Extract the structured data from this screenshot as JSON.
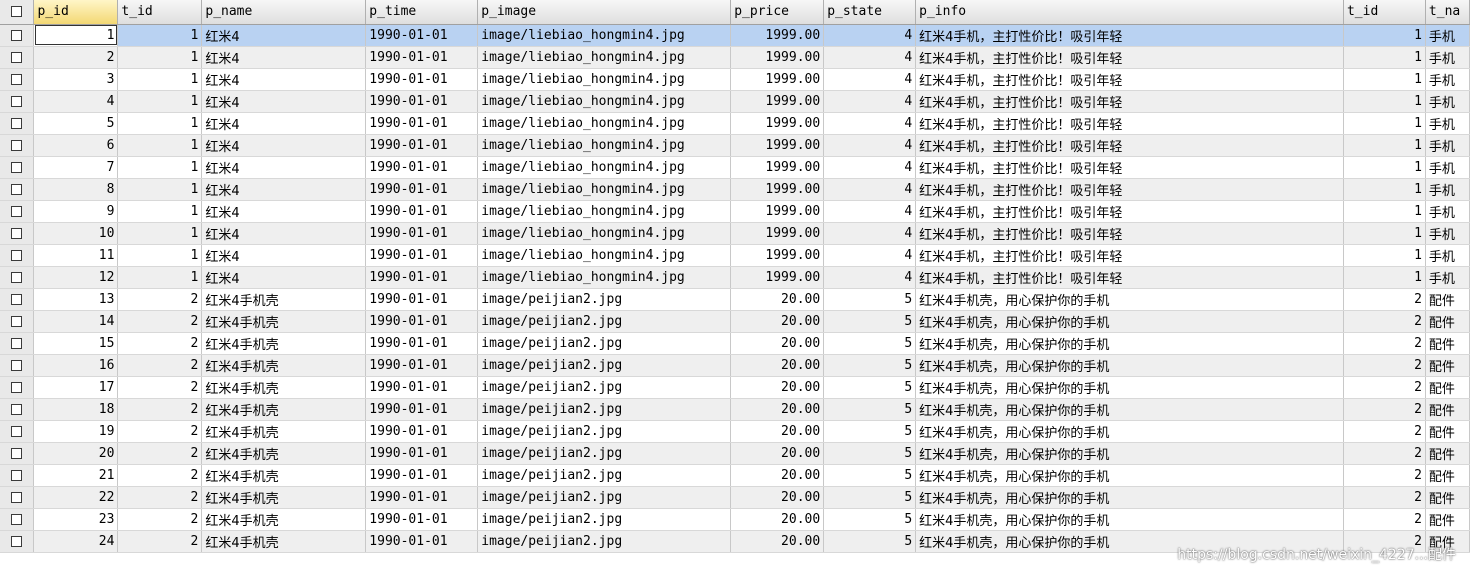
{
  "columns": [
    "p_id",
    "t_id",
    "p_name",
    "p_time",
    "p_image",
    "p_price",
    "p_state",
    "p_info",
    "t_id",
    "t_na"
  ],
  "rows": [
    [
      "1",
      "1",
      "红米4",
      "1990-01-01",
      "image/liebiao_hongmin4.jpg",
      "1999.00",
      "4",
      "红米4手机，主打性价比！吸引年轻",
      "1",
      "手机"
    ],
    [
      "2",
      "1",
      "红米4",
      "1990-01-01",
      "image/liebiao_hongmin4.jpg",
      "1999.00",
      "4",
      "红米4手机，主打性价比！吸引年轻",
      "1",
      "手机"
    ],
    [
      "3",
      "1",
      "红米4",
      "1990-01-01",
      "image/liebiao_hongmin4.jpg",
      "1999.00",
      "4",
      "红米4手机，主打性价比！吸引年轻",
      "1",
      "手机"
    ],
    [
      "4",
      "1",
      "红米4",
      "1990-01-01",
      "image/liebiao_hongmin4.jpg",
      "1999.00",
      "4",
      "红米4手机，主打性价比！吸引年轻",
      "1",
      "手机"
    ],
    [
      "5",
      "1",
      "红米4",
      "1990-01-01",
      "image/liebiao_hongmin4.jpg",
      "1999.00",
      "4",
      "红米4手机，主打性价比！吸引年轻",
      "1",
      "手机"
    ],
    [
      "6",
      "1",
      "红米4",
      "1990-01-01",
      "image/liebiao_hongmin4.jpg",
      "1999.00",
      "4",
      "红米4手机，主打性价比！吸引年轻",
      "1",
      "手机"
    ],
    [
      "7",
      "1",
      "红米4",
      "1990-01-01",
      "image/liebiao_hongmin4.jpg",
      "1999.00",
      "4",
      "红米4手机，主打性价比！吸引年轻",
      "1",
      "手机"
    ],
    [
      "8",
      "1",
      "红米4",
      "1990-01-01",
      "image/liebiao_hongmin4.jpg",
      "1999.00",
      "4",
      "红米4手机，主打性价比！吸引年轻",
      "1",
      "手机"
    ],
    [
      "9",
      "1",
      "红米4",
      "1990-01-01",
      "image/liebiao_hongmin4.jpg",
      "1999.00",
      "4",
      "红米4手机，主打性价比！吸引年轻",
      "1",
      "手机"
    ],
    [
      "10",
      "1",
      "红米4",
      "1990-01-01",
      "image/liebiao_hongmin4.jpg",
      "1999.00",
      "4",
      "红米4手机，主打性价比！吸引年轻",
      "1",
      "手机"
    ],
    [
      "11",
      "1",
      "红米4",
      "1990-01-01",
      "image/liebiao_hongmin4.jpg",
      "1999.00",
      "4",
      "红米4手机，主打性价比！吸引年轻",
      "1",
      "手机"
    ],
    [
      "12",
      "1",
      "红米4",
      "1990-01-01",
      "image/liebiao_hongmin4.jpg",
      "1999.00",
      "4",
      "红米4手机，主打性价比！吸引年轻",
      "1",
      "手机"
    ],
    [
      "13",
      "2",
      "红米4手机壳",
      "1990-01-01",
      "image/peijian2.jpg",
      "20.00",
      "5",
      "红米4手机壳，用心保护你的手机",
      "2",
      "配件"
    ],
    [
      "14",
      "2",
      "红米4手机壳",
      "1990-01-01",
      "image/peijian2.jpg",
      "20.00",
      "5",
      "红米4手机壳，用心保护你的手机",
      "2",
      "配件"
    ],
    [
      "15",
      "2",
      "红米4手机壳",
      "1990-01-01",
      "image/peijian2.jpg",
      "20.00",
      "5",
      "红米4手机壳，用心保护你的手机",
      "2",
      "配件"
    ],
    [
      "16",
      "2",
      "红米4手机壳",
      "1990-01-01",
      "image/peijian2.jpg",
      "20.00",
      "5",
      "红米4手机壳，用心保护你的手机",
      "2",
      "配件"
    ],
    [
      "17",
      "2",
      "红米4手机壳",
      "1990-01-01",
      "image/peijian2.jpg",
      "20.00",
      "5",
      "红米4手机壳，用心保护你的手机",
      "2",
      "配件"
    ],
    [
      "18",
      "2",
      "红米4手机壳",
      "1990-01-01",
      "image/peijian2.jpg",
      "20.00",
      "5",
      "红米4手机壳，用心保护你的手机",
      "2",
      "配件"
    ],
    [
      "19",
      "2",
      "红米4手机壳",
      "1990-01-01",
      "image/peijian2.jpg",
      "20.00",
      "5",
      "红米4手机壳，用心保护你的手机",
      "2",
      "配件"
    ],
    [
      "20",
      "2",
      "红米4手机壳",
      "1990-01-01",
      "image/peijian2.jpg",
      "20.00",
      "5",
      "红米4手机壳，用心保护你的手机",
      "2",
      "配件"
    ],
    [
      "21",
      "2",
      "红米4手机壳",
      "1990-01-01",
      "image/peijian2.jpg",
      "20.00",
      "5",
      "红米4手机壳，用心保护你的手机",
      "2",
      "配件"
    ],
    [
      "22",
      "2",
      "红米4手机壳",
      "1990-01-01",
      "image/peijian2.jpg",
      "20.00",
      "5",
      "红米4手机壳，用心保护你的手机",
      "2",
      "配件"
    ],
    [
      "23",
      "2",
      "红米4手机壳",
      "1990-01-01",
      "image/peijian2.jpg",
      "20.00",
      "5",
      "红米4手机壳，用心保护你的手机",
      "2",
      "配件"
    ],
    [
      "24",
      "2",
      "红米4手机壳",
      "1990-01-01",
      "image/peijian2.jpg",
      "20.00",
      "5",
      "红米4手机壳，用心保护你的手机",
      "2",
      "配件"
    ]
  ],
  "watermark": "https://blog.csdn.net/weixin_4227...配件",
  "active_row": 0,
  "colors": {
    "header_sort": "#f3d874",
    "selected_row": "#b9d2f2",
    "stripe": "#efefef"
  }
}
